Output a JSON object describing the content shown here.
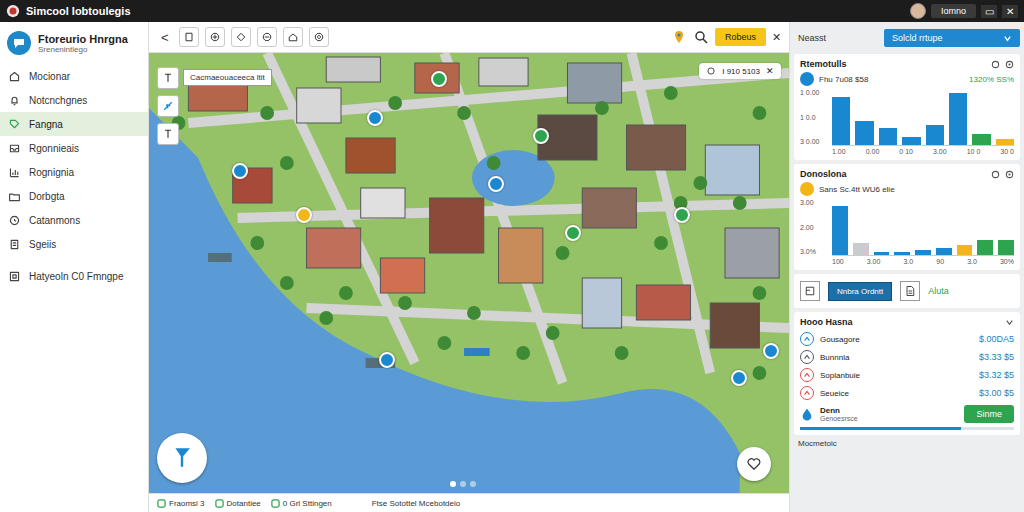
{
  "app": {
    "title": "Simcool Iobtoulegis",
    "user": "Iomno",
    "window_controls": [
      "▭",
      "✕"
    ]
  },
  "sidebar": {
    "brand": "Ftoreurio Hnrgna",
    "subtitle": "Srenenintlego",
    "items": [
      {
        "label": "Mocionar",
        "selected": false
      },
      {
        "label": "Notcnchgnes",
        "selected": false
      },
      {
        "label": "Fangna",
        "selected": true
      },
      {
        "label": "Rgonnieais",
        "selected": false
      },
      {
        "label": "Rognignia",
        "selected": false
      },
      {
        "label": "Dorbgta",
        "selected": false
      },
      {
        "label": "Catanmons",
        "selected": false
      },
      {
        "label": "Sgeiis",
        "selected": false
      },
      {
        "label": "Hatyeoln C0 Fmngpe",
        "selected": false
      }
    ]
  },
  "toolbar": {
    "back": "<",
    "button": "Robeus",
    "close": "✕"
  },
  "map": {
    "label": "Cacmaeouaceeca ltit",
    "info": "I 910 5103",
    "info_close": "✕",
    "carousel": [
      {
        "selected": true
      },
      {
        "selected": false
      },
      {
        "selected": false
      }
    ]
  },
  "status_bar": {
    "items": [
      "Fraomsi 3",
      "Dotantiee",
      "0 Grl Sttingen"
    ],
    "center": "Ftse Sotottel Mcebotdeio"
  },
  "panel": {
    "title": "Neasst",
    "select": "Solcld rrtupe"
  },
  "charts": [
    {
      "title": "Rtemotulls",
      "icon_color": "#1a88d0",
      "legend": "Fhu 7u08 $58",
      "legend_value": "1320% SS%",
      "y_ticks": [
        "1 0.00",
        "1 0.0",
        "3 0.00"
      ],
      "x_labels": [
        "1.00",
        "0.00",
        "0 10",
        "3.00",
        "10 0",
        "30 0"
      ],
      "bars": [
        {
          "value": 85,
          "color": "#1a88d0"
        },
        {
          "value": 42,
          "color": "#1a88d0"
        },
        {
          "value": 30,
          "color": "#1a88d0"
        },
        {
          "value": 15,
          "color": "#1a88d0"
        },
        {
          "value": 36,
          "color": "#1a88d0"
        },
        {
          "value": 92,
          "color": "#1a88d0"
        },
        {
          "value": 20,
          "color": "#2ea44f"
        },
        {
          "value": 11,
          "color": "#f2b619"
        }
      ]
    },
    {
      "title": "Donoslona",
      "icon_color": "#f2b619",
      "legend": "Sans Sc.4tt WU6 elie",
      "y_ticks": [
        "3.00",
        "2.00",
        "3.0%"
      ],
      "x_labels": [
        "100",
        "3.00",
        "3.0",
        "90",
        "3.0",
        "30%"
      ],
      "bars": [
        {
          "value": 88,
          "color": "#1a88d0"
        },
        {
          "value": 22,
          "color": "#c8ccd0"
        },
        {
          "value": 6,
          "color": "#1a88d0"
        },
        {
          "value": 6,
          "color": "#1a88d0"
        },
        {
          "value": 9,
          "color": "#1a88d0"
        },
        {
          "value": 12,
          "color": "#1a88d0"
        },
        {
          "value": 18,
          "color": "#f2b619"
        },
        {
          "value": 27,
          "color": "#2ea44f"
        },
        {
          "value": 27,
          "color": "#2ea44f"
        }
      ]
    }
  ],
  "actions": {
    "primary": "Nnbra Ordntt",
    "secondary": "Aluta"
  },
  "list": {
    "title": "Hooo Hasna",
    "rows": [
      {
        "label": "Gousagore",
        "value": "$.00DA5",
        "color": "#1a88d0"
      },
      {
        "label": "Bunnnla",
        "value": "$3.33 $5",
        "color": "#555b61"
      },
      {
        "label": "Soplanbuie",
        "value": "$3.32 $5",
        "color": "#d9534f"
      },
      {
        "label": "Seueice",
        "value": "$3.00 $5",
        "color": "#d9534f"
      }
    ],
    "item": {
      "title": "Denn",
      "subtitle": "Genoesrsce",
      "button": "Sinme",
      "level": 0.75
    },
    "footer": "Mocmetoic"
  }
}
